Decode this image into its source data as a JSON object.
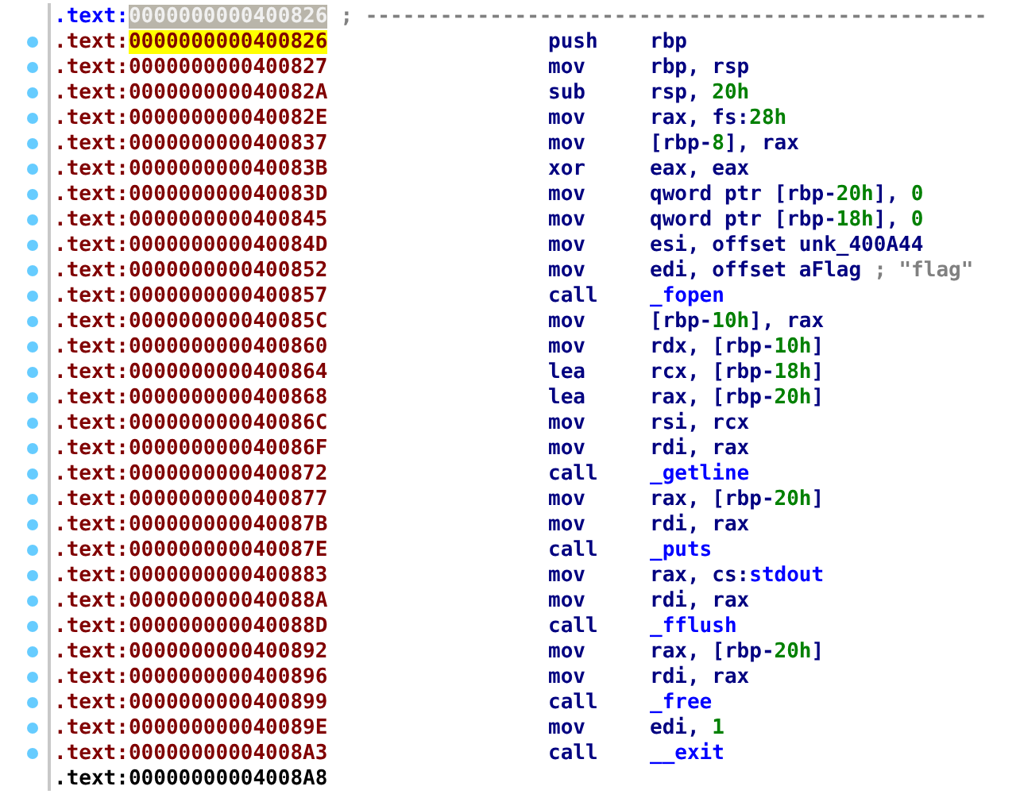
{
  "rows": [
    {
      "kind": "separator",
      "segment": ".text:",
      "address": "0000000000400826",
      "marker": false,
      "selected": false,
      "comment": "; --------------------------------------------------"
    },
    {
      "kind": "instruction",
      "segment": ".text:",
      "address": "0000000000400826",
      "marker": true,
      "selected": true,
      "mnemonic": "push",
      "operand": [
        {
          "kind": "plain",
          "text": "rbp"
        }
      ]
    },
    {
      "kind": "instruction",
      "segment": ".text:",
      "address": "0000000000400827",
      "marker": true,
      "selected": false,
      "mnemonic": "mov",
      "operand": [
        {
          "kind": "plain",
          "text": "rbp, rsp"
        }
      ]
    },
    {
      "kind": "instruction",
      "segment": ".text:",
      "address": "000000000040082A",
      "marker": true,
      "selected": false,
      "mnemonic": "sub",
      "operand": [
        {
          "kind": "plain",
          "text": "rsp, "
        },
        {
          "kind": "number",
          "text": "20h"
        }
      ]
    },
    {
      "kind": "instruction",
      "segment": ".text:",
      "address": "000000000040082E",
      "marker": true,
      "selected": false,
      "mnemonic": "mov",
      "operand": [
        {
          "kind": "plain",
          "text": "rax, fs:"
        },
        {
          "kind": "number",
          "text": "28h"
        }
      ]
    },
    {
      "kind": "instruction",
      "segment": ".text:",
      "address": "0000000000400837",
      "marker": true,
      "selected": false,
      "mnemonic": "mov",
      "operand": [
        {
          "kind": "plain",
          "text": "[rbp-"
        },
        {
          "kind": "number",
          "text": "8"
        },
        {
          "kind": "plain",
          "text": "], rax"
        }
      ]
    },
    {
      "kind": "instruction",
      "segment": ".text:",
      "address": "000000000040083B",
      "marker": true,
      "selected": false,
      "mnemonic": "xor",
      "operand": [
        {
          "kind": "plain",
          "text": "eax, eax"
        }
      ]
    },
    {
      "kind": "instruction",
      "segment": ".text:",
      "address": "000000000040083D",
      "marker": true,
      "selected": false,
      "mnemonic": "mov",
      "operand": [
        {
          "kind": "plain",
          "text": "qword ptr [rbp-"
        },
        {
          "kind": "number",
          "text": "20h"
        },
        {
          "kind": "plain",
          "text": "], "
        },
        {
          "kind": "number",
          "text": "0"
        }
      ]
    },
    {
      "kind": "instruction",
      "segment": ".text:",
      "address": "0000000000400845",
      "marker": true,
      "selected": false,
      "mnemonic": "mov",
      "operand": [
        {
          "kind": "plain",
          "text": "qword ptr [rbp-"
        },
        {
          "kind": "number",
          "text": "18h"
        },
        {
          "kind": "plain",
          "text": "], "
        },
        {
          "kind": "number",
          "text": "0"
        }
      ]
    },
    {
      "kind": "instruction",
      "segment": ".text:",
      "address": "000000000040084D",
      "marker": true,
      "selected": false,
      "mnemonic": "mov",
      "operand": [
        {
          "kind": "plain",
          "text": "esi, offset unk_400A44"
        }
      ]
    },
    {
      "kind": "instruction",
      "segment": ".text:",
      "address": "0000000000400852",
      "marker": true,
      "selected": false,
      "mnemonic": "mov",
      "operand": [
        {
          "kind": "plain",
          "text": "edi, offset aFlag"
        }
      ],
      "comment": "; \"flag\""
    },
    {
      "kind": "instruction",
      "segment": ".text:",
      "address": "0000000000400857",
      "marker": true,
      "selected": false,
      "mnemonic": "call",
      "operand": [
        {
          "kind": "name",
          "text": "_fopen"
        }
      ]
    },
    {
      "kind": "instruction",
      "segment": ".text:",
      "address": "000000000040085C",
      "marker": true,
      "selected": false,
      "mnemonic": "mov",
      "operand": [
        {
          "kind": "plain",
          "text": "[rbp-"
        },
        {
          "kind": "number",
          "text": "10h"
        },
        {
          "kind": "plain",
          "text": "], rax"
        }
      ]
    },
    {
      "kind": "instruction",
      "segment": ".text:",
      "address": "0000000000400860",
      "marker": true,
      "selected": false,
      "mnemonic": "mov",
      "operand": [
        {
          "kind": "plain",
          "text": "rdx, [rbp-"
        },
        {
          "kind": "number",
          "text": "10h"
        },
        {
          "kind": "plain",
          "text": "]"
        }
      ]
    },
    {
      "kind": "instruction",
      "segment": ".text:",
      "address": "0000000000400864",
      "marker": true,
      "selected": false,
      "mnemonic": "lea",
      "operand": [
        {
          "kind": "plain",
          "text": "rcx, [rbp-"
        },
        {
          "kind": "number",
          "text": "18h"
        },
        {
          "kind": "plain",
          "text": "]"
        }
      ]
    },
    {
      "kind": "instruction",
      "segment": ".text:",
      "address": "0000000000400868",
      "marker": true,
      "selected": false,
      "mnemonic": "lea",
      "operand": [
        {
          "kind": "plain",
          "text": "rax, [rbp-"
        },
        {
          "kind": "number",
          "text": "20h"
        },
        {
          "kind": "plain",
          "text": "]"
        }
      ]
    },
    {
      "kind": "instruction",
      "segment": ".text:",
      "address": "000000000040086C",
      "marker": true,
      "selected": false,
      "mnemonic": "mov",
      "operand": [
        {
          "kind": "plain",
          "text": "rsi, rcx"
        }
      ]
    },
    {
      "kind": "instruction",
      "segment": ".text:",
      "address": "000000000040086F",
      "marker": true,
      "selected": false,
      "mnemonic": "mov",
      "operand": [
        {
          "kind": "plain",
          "text": "rdi, rax"
        }
      ]
    },
    {
      "kind": "instruction",
      "segment": ".text:",
      "address": "0000000000400872",
      "marker": true,
      "selected": false,
      "mnemonic": "call",
      "operand": [
        {
          "kind": "name",
          "text": "_getline"
        }
      ]
    },
    {
      "kind": "instruction",
      "segment": ".text:",
      "address": "0000000000400877",
      "marker": true,
      "selected": false,
      "mnemonic": "mov",
      "operand": [
        {
          "kind": "plain",
          "text": "rax, [rbp-"
        },
        {
          "kind": "number",
          "text": "20h"
        },
        {
          "kind": "plain",
          "text": "]"
        }
      ]
    },
    {
      "kind": "instruction",
      "segment": ".text:",
      "address": "000000000040087B",
      "marker": true,
      "selected": false,
      "mnemonic": "mov",
      "operand": [
        {
          "kind": "plain",
          "text": "rdi, rax"
        }
      ]
    },
    {
      "kind": "instruction",
      "segment": ".text:",
      "address": "000000000040087E",
      "marker": true,
      "selected": false,
      "mnemonic": "call",
      "operand": [
        {
          "kind": "name",
          "text": "_puts"
        }
      ]
    },
    {
      "kind": "instruction",
      "segment": ".text:",
      "address": "0000000000400883",
      "marker": true,
      "selected": false,
      "mnemonic": "mov",
      "operand": [
        {
          "kind": "plain",
          "text": "rax, cs:"
        },
        {
          "kind": "name",
          "text": "stdout"
        }
      ]
    },
    {
      "kind": "instruction",
      "segment": ".text:",
      "address": "000000000040088A",
      "marker": true,
      "selected": false,
      "mnemonic": "mov",
      "operand": [
        {
          "kind": "plain",
          "text": "rdi, rax"
        }
      ]
    },
    {
      "kind": "instruction",
      "segment": ".text:",
      "address": "000000000040088D",
      "marker": true,
      "selected": false,
      "mnemonic": "call",
      "operand": [
        {
          "kind": "name",
          "text": "_fflush"
        }
      ]
    },
    {
      "kind": "instruction",
      "segment": ".text:",
      "address": "0000000000400892",
      "marker": true,
      "selected": false,
      "mnemonic": "mov",
      "operand": [
        {
          "kind": "plain",
          "text": "rax, [rbp-"
        },
        {
          "kind": "number",
          "text": "20h"
        },
        {
          "kind": "plain",
          "text": "]"
        }
      ]
    },
    {
      "kind": "instruction",
      "segment": ".text:",
      "address": "0000000000400896",
      "marker": true,
      "selected": false,
      "mnemonic": "mov",
      "operand": [
        {
          "kind": "plain",
          "text": "rdi, rax"
        }
      ]
    },
    {
      "kind": "instruction",
      "segment": ".text:",
      "address": "0000000000400899",
      "marker": true,
      "selected": false,
      "mnemonic": "call",
      "operand": [
        {
          "kind": "name",
          "text": "_free"
        }
      ]
    },
    {
      "kind": "instruction",
      "segment": ".text:",
      "address": "000000000040089E",
      "marker": true,
      "selected": false,
      "mnemonic": "mov",
      "operand": [
        {
          "kind": "plain",
          "text": "edi, "
        },
        {
          "kind": "number",
          "text": "1"
        }
      ]
    },
    {
      "kind": "instruction",
      "segment": ".text:",
      "address": "00000000004008A3",
      "marker": true,
      "selected": false,
      "mnemonic": "call",
      "operand": [
        {
          "kind": "name",
          "text": "__exit"
        }
      ]
    },
    {
      "kind": "end",
      "segment": ".text:",
      "address": "00000000004008A8",
      "marker": false,
      "selected": false
    }
  ]
}
